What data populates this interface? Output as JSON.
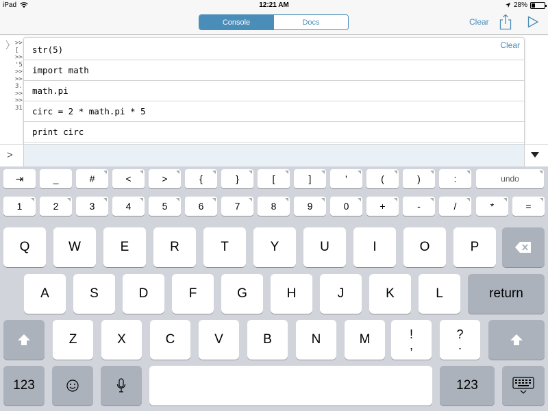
{
  "status_bar": {
    "device": "iPad",
    "time": "12:21 AM",
    "battery": "28%",
    "battery_level": 0.28
  },
  "nav": {
    "tabs": [
      "Console",
      "Docs"
    ],
    "active_tab": "Console",
    "clear_label": "Clear"
  },
  "console": {
    "partial_lines": [
      ">>",
      "[",
      ">>",
      "'5",
      ">>",
      ">>",
      "3.",
      ">>",
      ">>",
      "31"
    ]
  },
  "history": {
    "clear_label": "Clear",
    "items": [
      "str(5)",
      "import math",
      "math.pi",
      "circ = 2 * math.pi * 5",
      "print circ"
    ]
  },
  "input": {
    "prompt": ">",
    "value": ""
  },
  "keyboard": {
    "accessory_row1": [
      "⇥",
      "_",
      "#",
      "<",
      ">",
      "{",
      "}",
      "[",
      "]",
      "'",
      "(",
      ")",
      ":",
      "undo"
    ],
    "accessory_row2": [
      "1",
      "2",
      "3",
      "4",
      "5",
      "6",
      "7",
      "8",
      "9",
      "0",
      "+",
      "-",
      "/",
      "*",
      "="
    ],
    "row1": [
      "Q",
      "W",
      "E",
      "R",
      "T",
      "Y",
      "U",
      "I",
      "O",
      "P"
    ],
    "row2": [
      "A",
      "S",
      "D",
      "F",
      "G",
      "H",
      "J",
      "K",
      "L"
    ],
    "row2_return": "return",
    "row3": [
      "Z",
      "X",
      "C",
      "V",
      "B",
      "N",
      "M"
    ],
    "row3_punct1": [
      "!",
      ","
    ],
    "row3_punct2": [
      "?",
      "."
    ],
    "bottom_left_123": "123",
    "bottom_right_123": "123"
  }
}
